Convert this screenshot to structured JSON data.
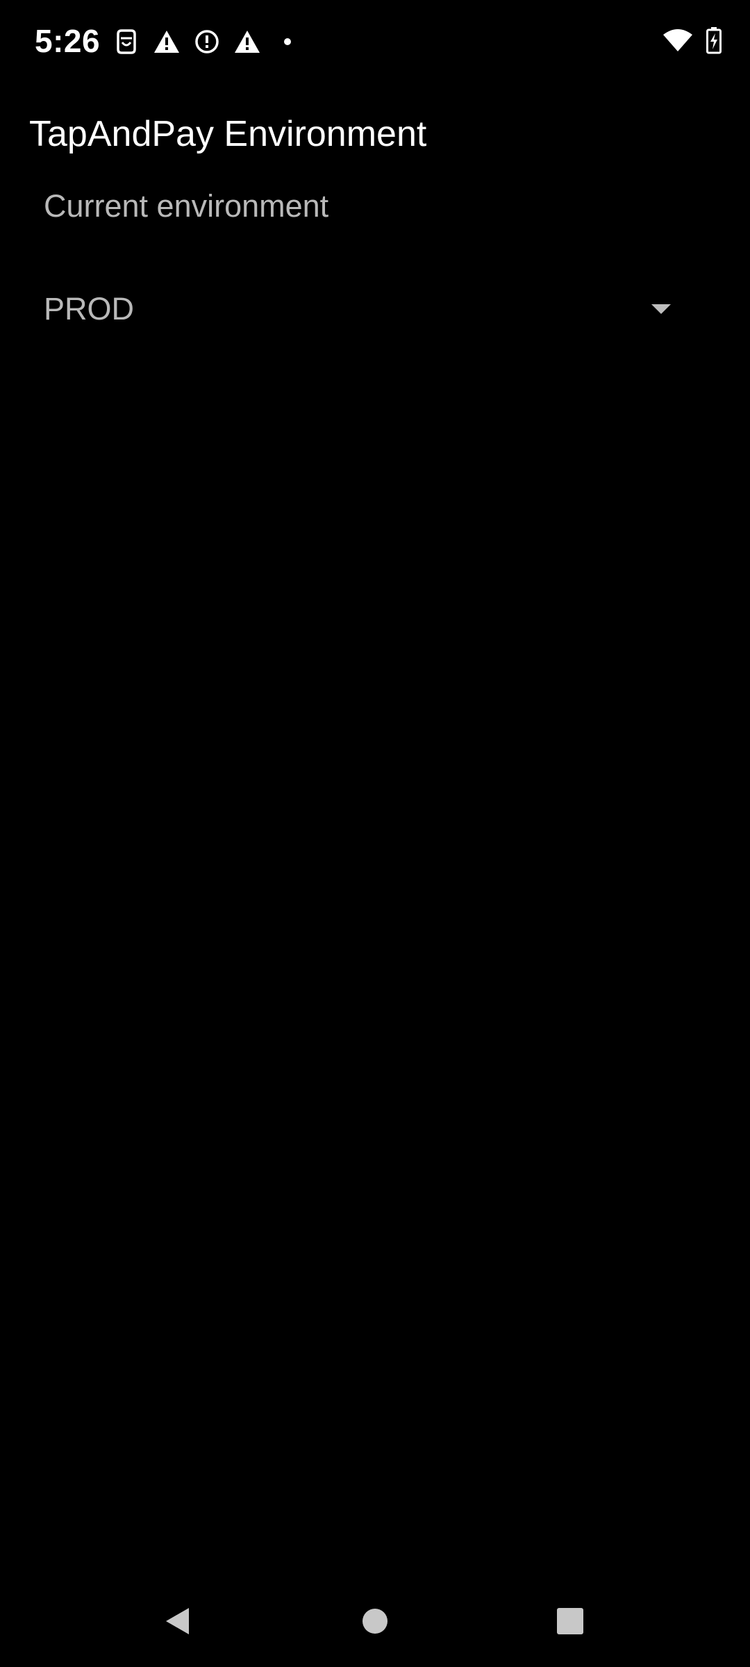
{
  "status_bar": {
    "time": "5:26",
    "left_icons": [
      "sim-card-icon",
      "warning-icon",
      "alert-circle-icon",
      "warning-icon",
      "notification-dot-icon"
    ],
    "right_icons": [
      "wifi-icon",
      "battery-charging-icon"
    ]
  },
  "app": {
    "title": "TapAndPay Environment"
  },
  "environment_field": {
    "label": "Current environment",
    "selected_value": "PROD"
  },
  "nav_bar": {
    "buttons": [
      "back-icon",
      "home-icon",
      "recents-icon"
    ]
  },
  "colors": {
    "background": "#000000",
    "primary_text": "#ffffff",
    "secondary_text": "#b9b9b9"
  }
}
